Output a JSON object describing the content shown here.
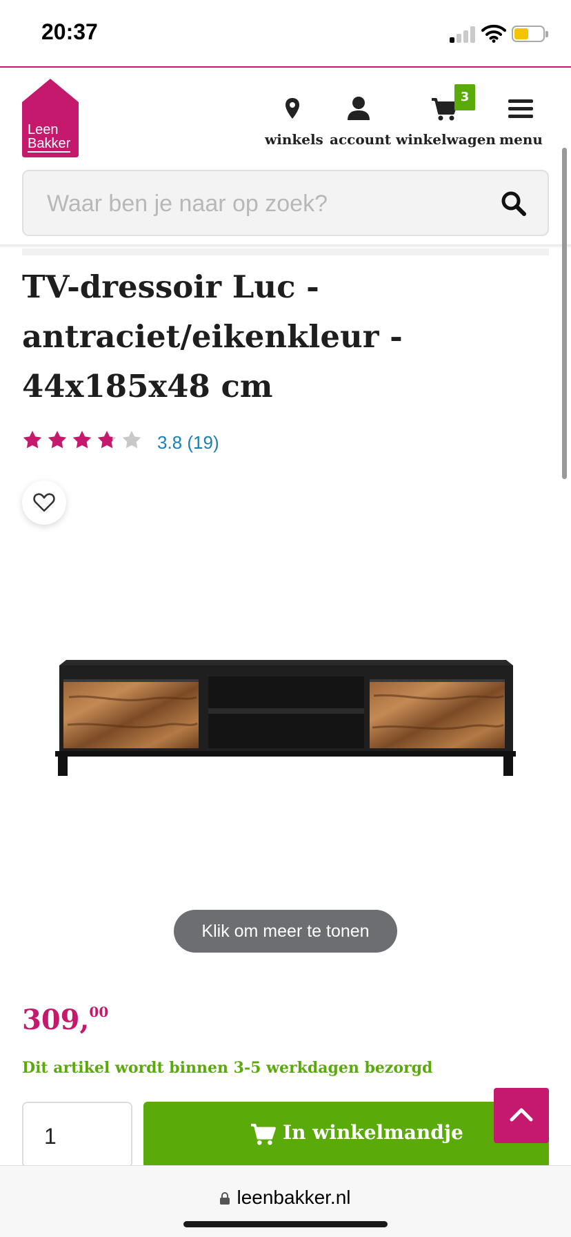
{
  "status_bar": {
    "time": "20:37",
    "battery_color": "#f5c400"
  },
  "brand": {
    "logo_line1": "Leen",
    "logo_line2": "Bakker",
    "accent": "#c5196e",
    "green": "#5aaa0a"
  },
  "nav": {
    "winkels": {
      "label": "winkels",
      "icon": "location-pin-icon"
    },
    "account": {
      "label": "account",
      "icon": "user-icon"
    },
    "cart": {
      "label": "winkelwagen",
      "icon": "cart-icon",
      "badge": "3"
    },
    "menu": {
      "label": "menu",
      "icon": "hamburger-icon"
    }
  },
  "search": {
    "placeholder": "Waar ben je naar op zoek?",
    "icon": "search-icon"
  },
  "product": {
    "title": "TV-dressoir Luc - antraciet/eikenkleur - 44x185x48 cm",
    "rating_value": 3.8,
    "rating_label": "3.8 (19)",
    "more_label": "Klik om meer te tonen",
    "price_main": "309,",
    "price_cents": "00",
    "delivery": "Dit artikel wordt binnen 3-5 werkdagen bezorgd",
    "quantity": "1",
    "add_to_cart": "In winkelmandje"
  },
  "browser": {
    "url": "leenbakker.nl"
  }
}
